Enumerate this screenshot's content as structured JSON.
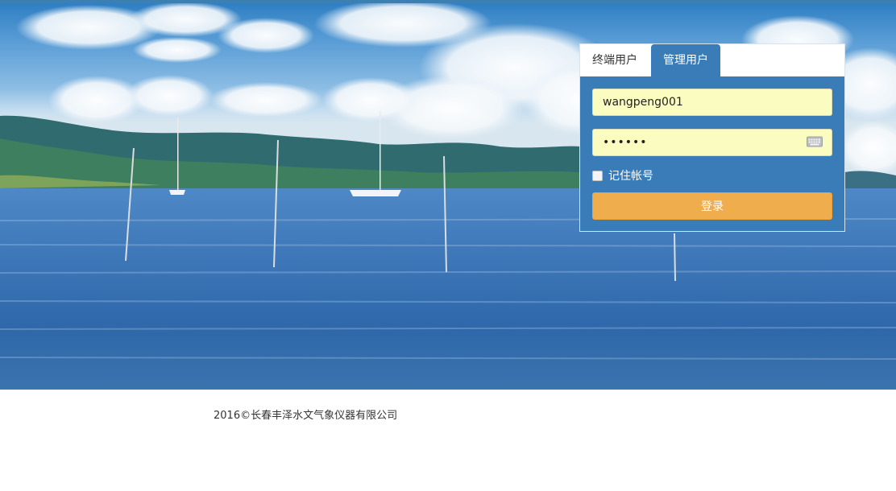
{
  "tabs": [
    {
      "label": "终端用户",
      "active": false
    },
    {
      "label": "管理用户",
      "active": true
    }
  ],
  "form": {
    "username_value": "wangpeng001",
    "password_value": "••••••",
    "remember_label": "记住帐号",
    "remember_checked": false,
    "login_label": "登录"
  },
  "footer": {
    "copyright": "2016©长春丰泽水文气象仪器有限公司"
  },
  "colors": {
    "panel_bg": "#3a7cb8",
    "login_button": "#f0ad4e",
    "input_bg": "#fbfdc0"
  },
  "icons": {
    "password_keyboard": "keyboard-icon"
  }
}
